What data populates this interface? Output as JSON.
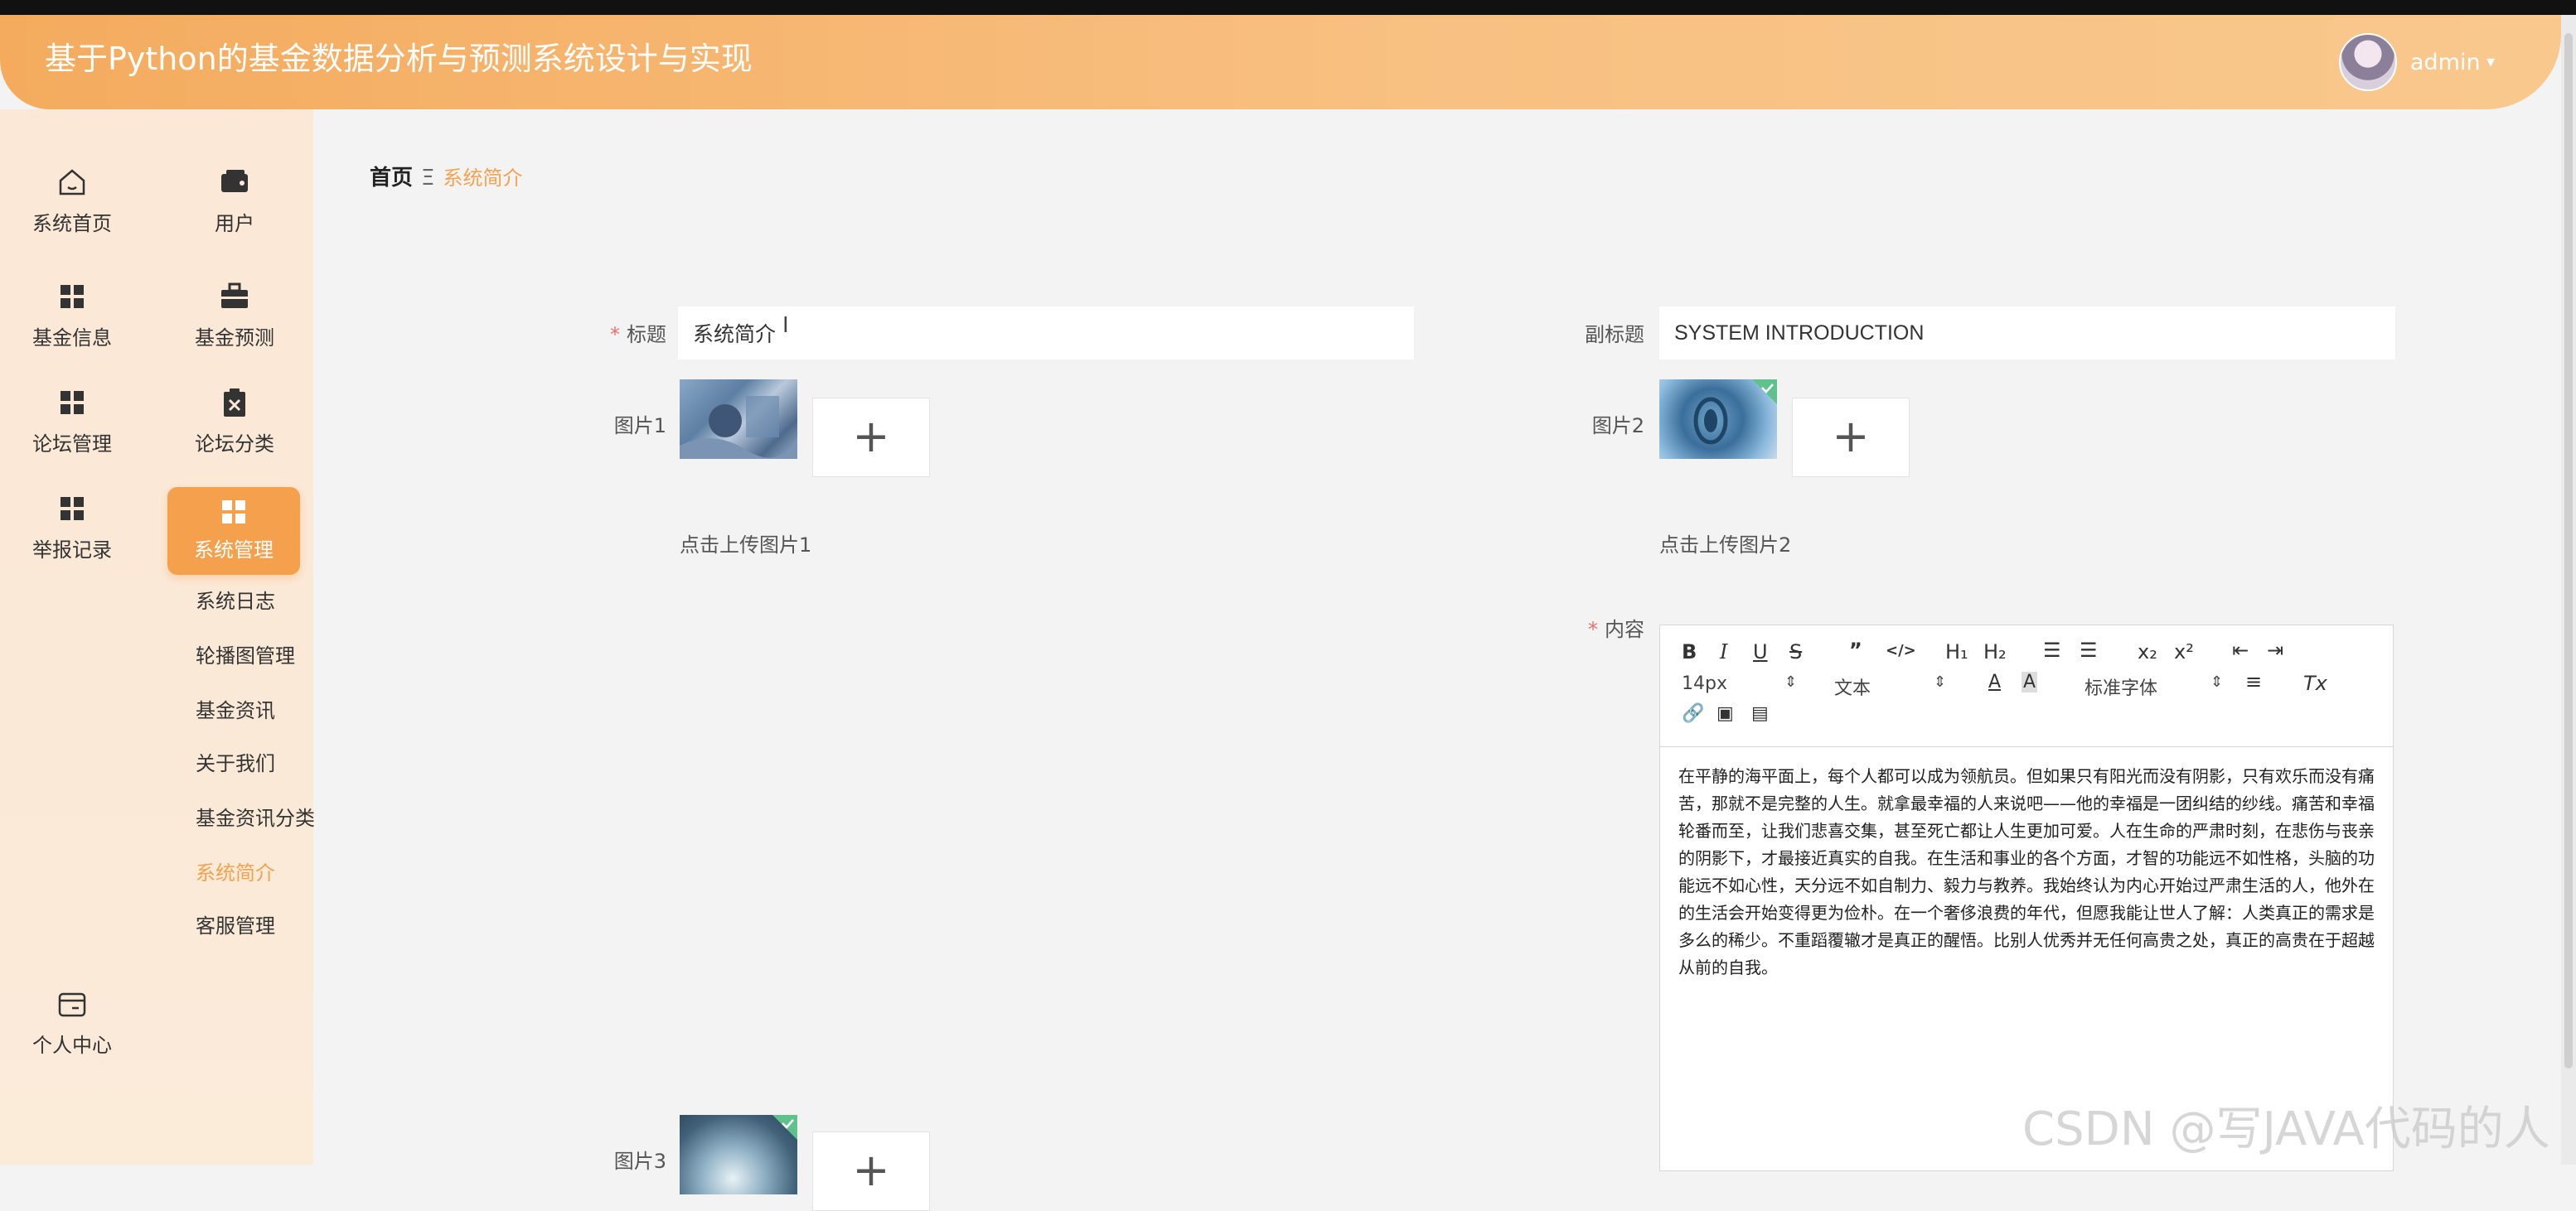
{
  "header": {
    "title": "基于Python的基金数据分析与预测系统设计与实现",
    "user": "admin"
  },
  "sidebar": {
    "items": [
      {
        "label": "系统首页",
        "icon": "home-icon"
      },
      {
        "label": "用户",
        "icon": "wallet-icon"
      },
      {
        "label": "基金信息",
        "icon": "grid-icon"
      },
      {
        "label": "基金预测",
        "icon": "briefcase-icon"
      },
      {
        "label": "论坛管理",
        "icon": "grid-icon"
      },
      {
        "label": "论坛分类",
        "icon": "clipboard-icon"
      },
      {
        "label": "举报记录",
        "icon": "grid-icon"
      },
      {
        "label": "系统管理",
        "icon": "grid-icon"
      }
    ],
    "sub_items": [
      "系统日志",
      "轮播图管理",
      "基金资讯",
      "关于我们",
      "基金资讯分类",
      "系统简介",
      "客服管理"
    ],
    "personal": {
      "label": "个人中心",
      "icon": "card-icon"
    }
  },
  "breadcrumb": {
    "home": "首页",
    "separator": "Ξ",
    "current": "系统简介"
  },
  "form": {
    "title_label": "标题",
    "title_value": "系统简介",
    "subtitle_label": "副标题",
    "subtitle_value": "SYSTEM INTRODUCTION",
    "image1_label": "图片1",
    "image1_hint": "点击上传图片1",
    "image2_label": "图片2",
    "image2_hint": "点击上传图片2",
    "image3_label": "图片3",
    "content_label": "内容",
    "upload_plus": "+"
  },
  "editor": {
    "font_size": "14px",
    "block_type": "文本",
    "font_family": "标准字体",
    "content": "在平静的海平面上，每个人都可以成为领航员。但如果只有阳光而没有阴影，只有欢乐而没有痛苦，那就不是完整的人生。就拿最幸福的人来说吧——他的幸福是一团纠结的纱线。痛苦和幸福轮番而至，让我们悲喜交集，甚至死亡都让人生更加可爱。人在生命的严肃时刻，在悲伤与丧亲的阴影下，才最接近真实的自我。在生活和事业的各个方面，才智的功能远不如性格，头脑的功能远不如心性，天分远不如自制力、毅力与教养。我始终认为内心开始过严肃生活的人，他外在的生活会开始变得更为俭朴。在一个奢侈浪费的年代，但愿我能让世人了解：人类真正的需求是多么的稀少。不重蹈覆辙才是真正的醒悟。比别人优秀并无任何高贵之处，真正的高贵在于超越从前的自我。"
  },
  "watermark": "CSDN @写JAVA代码的人",
  "colors": {
    "accent": "#f5a04c",
    "header_start": "#f4ab5e",
    "required": "#f56c6c"
  }
}
